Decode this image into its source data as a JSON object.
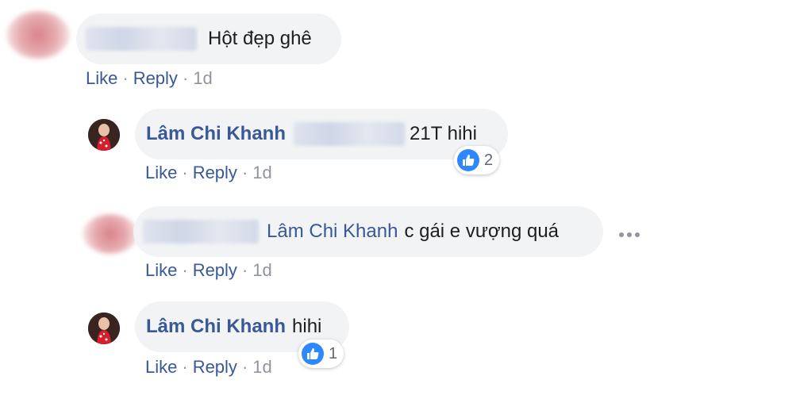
{
  "comments": [
    {
      "text": "Hột đẹp ghê",
      "actions": {
        "like": "Like",
        "reply": "Reply",
        "time": "1d"
      }
    },
    {
      "author": "Lâm Chi Khanh",
      "text": "21T hihi",
      "reactions": {
        "count": "2",
        "icon": "like-icon"
      },
      "actions": {
        "like": "Like",
        "reply": "Reply",
        "time": "1d"
      }
    },
    {
      "mention": "Lâm Chi Khanh",
      "text": "c gái e vượng quá",
      "actions": {
        "like": "Like",
        "reply": "Reply",
        "time": "1d"
      }
    },
    {
      "author": "Lâm Chi Khanh",
      "text": "hihi",
      "reactions": {
        "count": "1",
        "icon": "like-icon"
      },
      "actions": {
        "like": "Like",
        "reply": "Reply",
        "time": "1d"
      }
    }
  ],
  "separator": "·",
  "colors": {
    "link": "#385898",
    "bubble": "#f2f3f5",
    "meta": "#90949c",
    "like_blue": "#2d88ff"
  }
}
